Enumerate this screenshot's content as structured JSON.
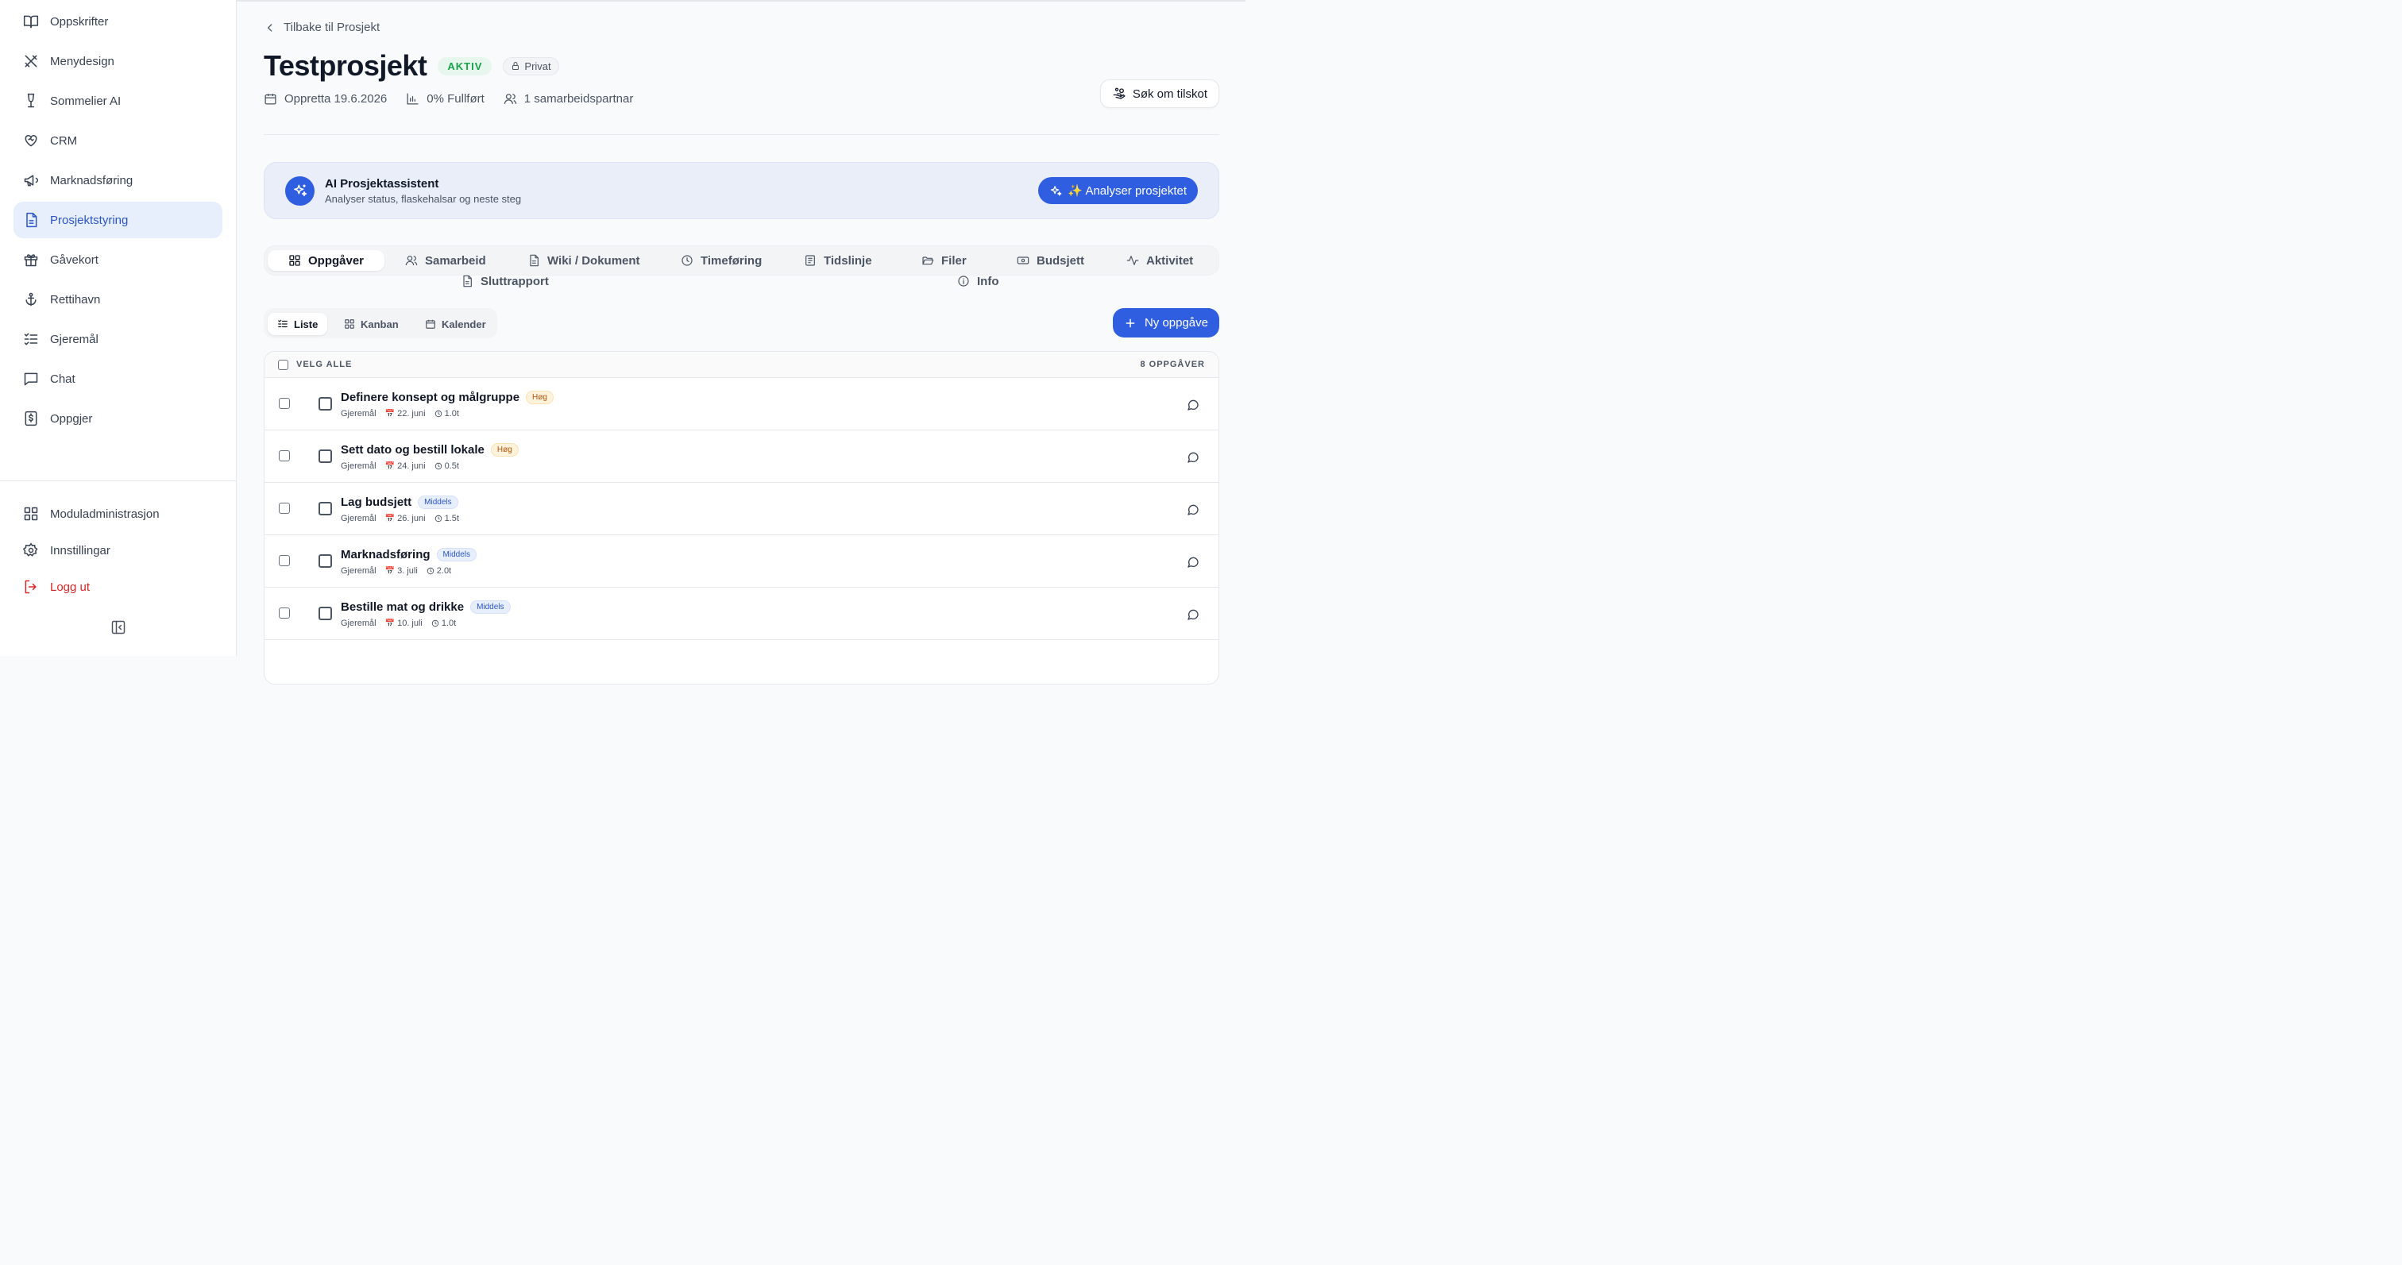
{
  "sidebar": {
    "items": [
      {
        "label": "Oppskrifter",
        "icon": "book-icon"
      },
      {
        "label": "Menydesign",
        "icon": "utensils-icon"
      },
      {
        "label": "Sommelier AI",
        "icon": "wine-glass-icon"
      },
      {
        "label": "CRM",
        "icon": "heart-handshake-icon"
      },
      {
        "label": "Marknadsføring",
        "icon": "megaphone-icon"
      },
      {
        "label": "Prosjektstyring",
        "icon": "document-icon",
        "active": true
      },
      {
        "label": "Gåvekort",
        "icon": "gift-icon"
      },
      {
        "label": "Rettihavn",
        "icon": "anchor-icon"
      },
      {
        "label": "Gjeremål",
        "icon": "checklist-icon"
      },
      {
        "label": "Chat",
        "icon": "chat-icon"
      },
      {
        "label": "Oppgjer",
        "icon": "receipt-dollar-icon"
      }
    ],
    "bottom": {
      "modules": "Moduladministrasjon",
      "settings": "Innstillingar",
      "logout": "Logg ut"
    }
  },
  "header": {
    "back_label": "Tilbake til Prosjekt",
    "title": "Testprosjekt",
    "status_badge": "AKTIV",
    "privacy_badge": "Privat",
    "created": "Oppretta 19.6.2026",
    "progress": "0% Fullført",
    "collaborators": "1 samarbeidspartnar",
    "apply_label": "Søk om tilskot"
  },
  "ai": {
    "title": "AI Prosjektassistent",
    "subtitle": "Analyser status, flaskehalsar og neste steg",
    "button": "✨ Analyser prosjektet"
  },
  "tabs": {
    "tasks": "Oppgåver",
    "collab": "Samarbeid",
    "wiki": "Wiki / Dokument",
    "time": "Timeføring",
    "timeline": "Tidslinje",
    "files": "Filer",
    "budget": "Budsjett",
    "activity": "Aktivitet",
    "report": "Sluttrapport",
    "info": "Info"
  },
  "views": {
    "list": "Liste",
    "kanban": "Kanban",
    "calendar": "Kalender"
  },
  "new_task_label": "Ny oppgåve",
  "table": {
    "select_all": "VELG ALLE",
    "count": "8 OPPGÅVER",
    "rows": [
      {
        "name": "Definere konsept og målgruppe",
        "priority": "Høg",
        "prio_class": "high",
        "category": "Gjeremål",
        "date": "22. juni",
        "hours": "1.0t"
      },
      {
        "name": "Sett dato og bestill lokale",
        "priority": "Høg",
        "prio_class": "high",
        "category": "Gjeremål",
        "date": "24. juni",
        "hours": "0.5t"
      },
      {
        "name": "Lag budsjett",
        "priority": "Middels",
        "prio_class": "mid",
        "category": "Gjeremål",
        "date": "26. juni",
        "hours": "1.5t"
      },
      {
        "name": "Marknadsføring",
        "priority": "Middels",
        "prio_class": "mid",
        "category": "Gjeremål",
        "date": "3. juli",
        "hours": "2.0t"
      },
      {
        "name": "Bestille mat og drikke",
        "priority": "Middels",
        "prio_class": "mid",
        "category": "Gjeremål",
        "date": "10. juli",
        "hours": "1.0t"
      }
    ]
  },
  "colors": {
    "accent": "#2f5ee0",
    "active_nav_bg": "#e8effc",
    "success": "#16a34a",
    "danger": "#dc2626"
  }
}
